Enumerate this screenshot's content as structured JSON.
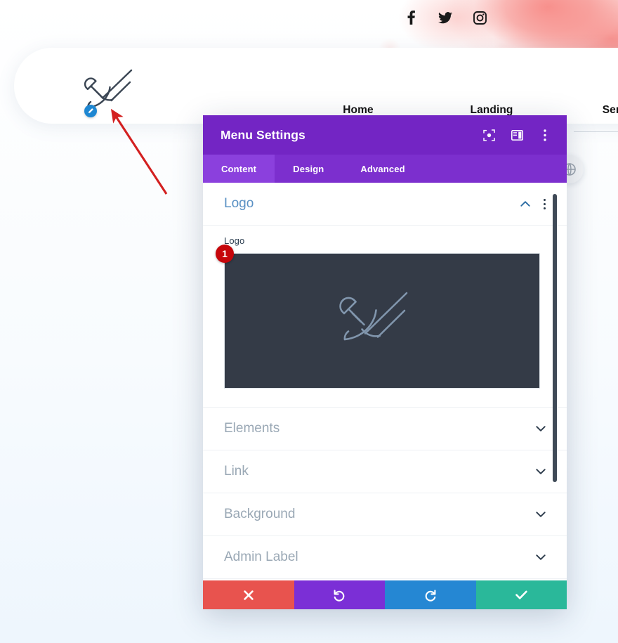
{
  "site": {
    "social": [
      {
        "name": "facebook-icon",
        "label": "Facebook"
      },
      {
        "name": "twitter-icon",
        "label": "Twitter"
      },
      {
        "name": "instagram-icon",
        "label": "Instagram"
      }
    ],
    "logo_alt": "Trowel Logo",
    "nav": [
      {
        "label": "Home"
      },
      {
        "label": "Landing"
      },
      {
        "label": "Services"
      }
    ],
    "edit_badge_icon": "pencil-icon",
    "globe_button_icon": "globe-icon"
  },
  "annotation": {
    "arrow_color": "#d32020",
    "number_badge": "1",
    "number_badge_color": "#c6060b"
  },
  "modal": {
    "title": "Menu Settings",
    "header_icons": [
      {
        "name": "fullscreen-icon"
      },
      {
        "name": "layout-view-icon"
      },
      {
        "name": "more-options-icon"
      }
    ],
    "tabs": [
      {
        "label": "Content",
        "active": true
      },
      {
        "label": "Design",
        "active": false
      },
      {
        "label": "Advanced",
        "active": false
      }
    ],
    "accent_color": "#7325c4",
    "tabbar_color": "#7c2fce",
    "active_tab_color": "#8b40dd",
    "open_section": {
      "title": "Logo",
      "collapse_icon": "chevron-up-icon",
      "menu_icon": "more-options-icon",
      "field_label": "Logo",
      "preview_background": "#343b47"
    },
    "sections": [
      {
        "title": "Elements",
        "icon": "chevron-down-icon"
      },
      {
        "title": "Link",
        "icon": "chevron-down-icon"
      },
      {
        "title": "Background",
        "icon": "chevron-down-icon"
      },
      {
        "title": "Admin Label",
        "icon": "chevron-down-icon"
      }
    ],
    "footer": [
      {
        "name": "cancel-button",
        "icon": "close-icon",
        "color": "#e8534e"
      },
      {
        "name": "undo-button",
        "icon": "undo-icon",
        "color": "#7b2fd6"
      },
      {
        "name": "redo-button",
        "icon": "redo-icon",
        "color": "#2587d3"
      },
      {
        "name": "save-button",
        "icon": "check-icon",
        "color": "#2ab89a"
      }
    ]
  }
}
